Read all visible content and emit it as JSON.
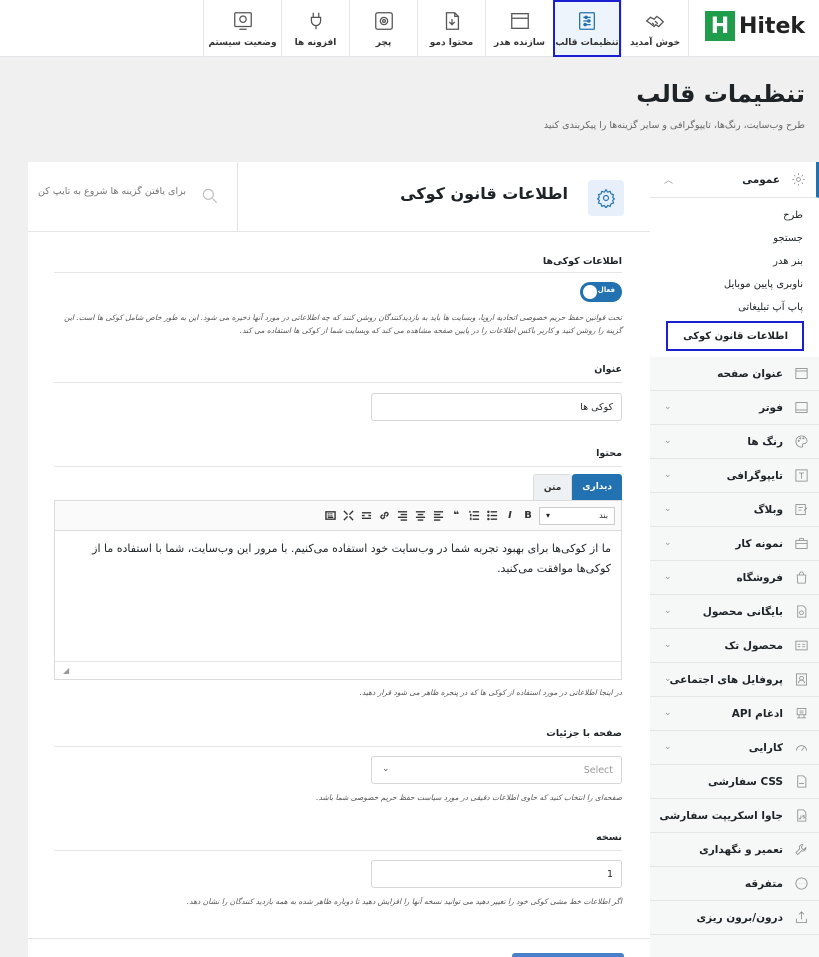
{
  "brand": {
    "name": "Hitek",
    "letter": "H"
  },
  "nav": [
    {
      "id": "welcome",
      "label": "خوش آمدید",
      "icon": "handshake-icon"
    },
    {
      "id": "theme-settings",
      "label": "تنظیمات قالب",
      "icon": "sliders-icon",
      "active": true
    },
    {
      "id": "header-builder",
      "label": "سازنده هدر",
      "icon": "window-icon"
    },
    {
      "id": "demo-content",
      "label": "محتوا دمو",
      "icon": "file-import-icon"
    },
    {
      "id": "patcher",
      "label": "پچر",
      "icon": "patcher-gear-icon"
    },
    {
      "id": "plugins",
      "label": "افزونه ها",
      "icon": "plug-icon"
    },
    {
      "id": "system-status",
      "label": "وضعیت سیستم",
      "icon": "status-gear-icon"
    }
  ],
  "page": {
    "title": "تنظیمات قالب",
    "subtitle": "طرح وب‌سایت، رنگ‌ها، تایپوگرافی و سایر گزینه‌ها را پیکربندی کنید"
  },
  "sidebar": {
    "general": {
      "label": "عمومی",
      "icon": "gear-icon"
    },
    "sub_items": [
      "طرح",
      "جستجو",
      "بنر هدر",
      "ناوبری پایین موبایل",
      "پاپ آپ تبلیغاتی",
      "اطلاعات قانون کوکی"
    ],
    "active_sub": "اطلاعات قانون کوکی",
    "items": [
      {
        "label": "عنوان صفحه",
        "icon": "page-title-icon",
        "chevron": false
      },
      {
        "label": "فوتر",
        "icon": "footer-icon",
        "chevron": true
      },
      {
        "label": "رنگ ها",
        "icon": "palette-icon",
        "chevron": true
      },
      {
        "label": "تایپوگرافی",
        "icon": "typography-icon",
        "chevron": true
      },
      {
        "label": "وبلاگ",
        "icon": "blog-icon",
        "chevron": true
      },
      {
        "label": "نمونه کار",
        "icon": "briefcase-icon",
        "chevron": true
      },
      {
        "label": "فروشگاه",
        "icon": "shopping-bag-icon",
        "chevron": true
      },
      {
        "label": "بایگانی محصول",
        "icon": "product-archive-icon",
        "chevron": true
      },
      {
        "label": "محصول تک",
        "icon": "single-product-icon",
        "chevron": true
      },
      {
        "label": "پروفایل های اجتماعی",
        "icon": "social-profile-icon",
        "chevron": true
      },
      {
        "label": "ادغام API",
        "icon": "api-icon",
        "chevron": true
      },
      {
        "label": "کارایی",
        "icon": "speedometer-icon",
        "chevron": true
      },
      {
        "label": "CSS سفارشی",
        "icon": "css-file-icon",
        "chevron": false
      },
      {
        "label": "جاوا اسکریپت سفارشی",
        "icon": "js-file-icon",
        "chevron": false
      },
      {
        "label": "تعمیر و نگهداری",
        "icon": "wrench-icon",
        "chevron": false
      },
      {
        "label": "متفرقه",
        "icon": "dots-circle-icon",
        "chevron": false
      },
      {
        "label": "درون/برون ریزی",
        "icon": "import-export-icon",
        "chevron": false
      }
    ]
  },
  "search": {
    "placeholder": "برای یافتن گزینه ها شروع به تایپ کن"
  },
  "section": {
    "title": "اطلاعات قانون کوکی",
    "icon": "gear-icon"
  },
  "fields": {
    "cookie_info": {
      "title": "اطلاعات کوکی‌ها",
      "toggle_label": "فعال",
      "enabled": true,
      "description": "تحت قوانین حفظ حریم خصوصی اتحادیه اروپا، وبسایت ها باید به بازدیدکنندگان روشن کنند که چه اطلاعاتی در مورد آنها ذخیره می شود. این به طور خاص شامل کوکی ها است. این گزینه را روشن کنید و کاربر باکس اطلاعات را در پایین صفحه مشاهده می کند که وبسایت شما از کوکی ها استفاده می کند."
    },
    "title": {
      "title": "عنوان",
      "value": "کوکی ها"
    },
    "content": {
      "title": "محتوا",
      "tab_visual": "دیداری",
      "tab_text": "متن",
      "paragraph": "بند",
      "body": "ما از کوکی‌ها برای بهبود تجربه شما در وب‌سایت خود استفاده می‌کنیم. با مرور این وب‌سایت، شما با استفاده ما از کوکی‌ها موافقت می‌کنید.",
      "description": "در اینجا اطلاعاتی در مورد استفاده از کوکی ها که در پنجره ظاهر می شود قرار دهید."
    },
    "details_page": {
      "title": "صفحه با جزئیات",
      "placeholder": "Select",
      "description": "صفحه‌ای را انتخاب کنید که حاوی اطلاعات دقیقی در مورد سیاست حفظ حریم خصوصی شما باشد."
    },
    "version": {
      "title": "نسخه",
      "value": "1",
      "description": "اگر اطلاعات خط مشی کوکی خود را تغییر دهید می توانید نسخه آنها را افزایش دهید تا دوباره ظاهر شده به همه بازدید کنندگان را نشان دهد."
    }
  }
}
